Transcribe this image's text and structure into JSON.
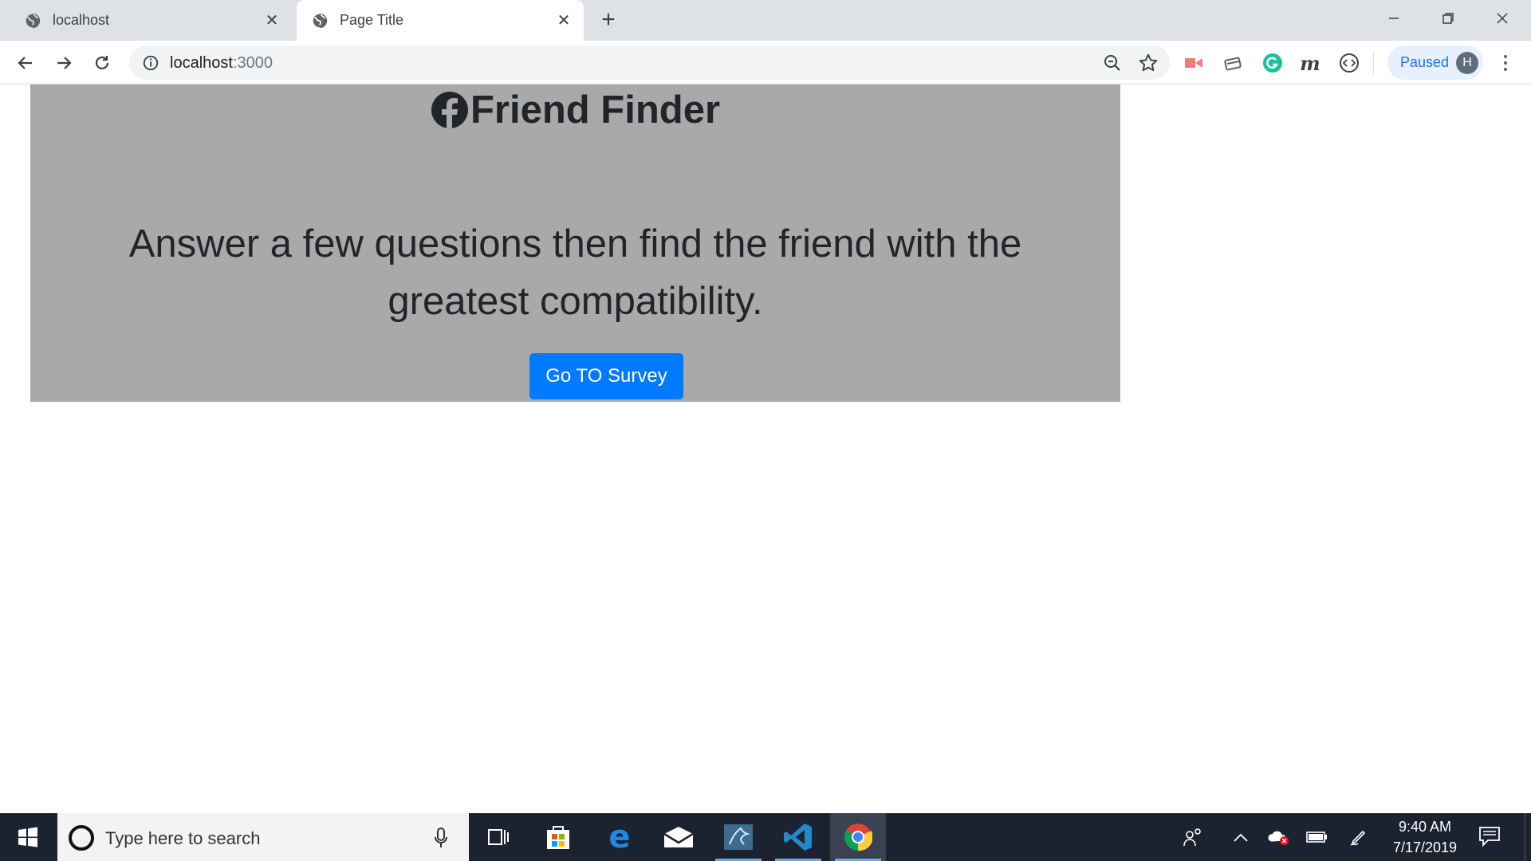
{
  "browser": {
    "tabs": [
      {
        "label": "localhost",
        "active": false
      },
      {
        "label": "Page Title",
        "active": true
      }
    ],
    "new_tab_label": "+",
    "address": {
      "host": "localhost",
      "port": ":3000"
    },
    "profile": {
      "status": "Paused",
      "initial": "H"
    },
    "window_controls": [
      "minimize",
      "restore",
      "close"
    ]
  },
  "page": {
    "title": "Friend Finder",
    "lead": "Answer a few questions then find the friend with the greatest compatibility.",
    "button_label": "Go TO Survey",
    "colors": {
      "jumbotron": "#a9a9a9",
      "button": "#007bff",
      "text": "#212529"
    }
  },
  "taskbar": {
    "search_placeholder": "Type here to search",
    "apps": [
      "task-view-icon",
      "store-icon",
      "edge-icon",
      "mail-icon",
      "mysql-workbench-icon",
      "vscode-icon",
      "chrome-icon"
    ],
    "clock": {
      "time": "9:40 AM",
      "date": "7/17/2019"
    }
  }
}
